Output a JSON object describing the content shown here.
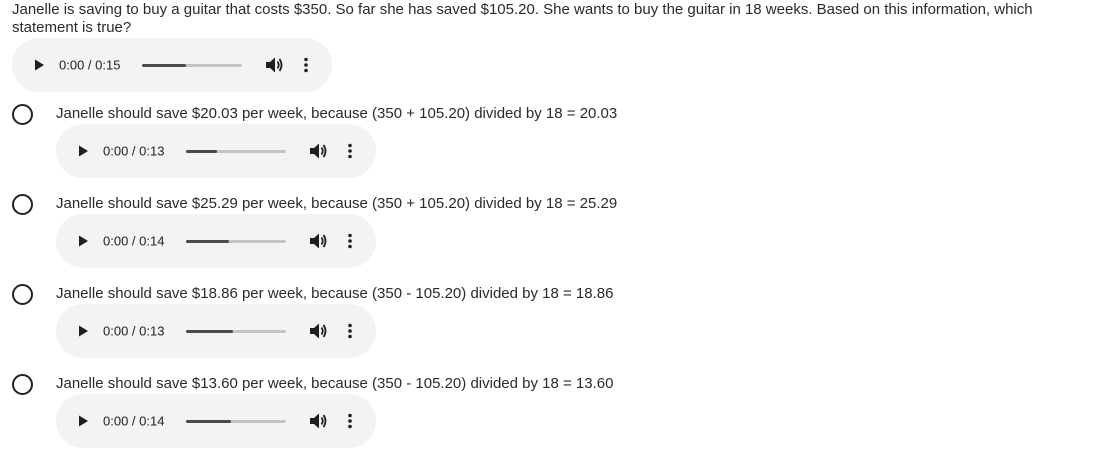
{
  "question": {
    "text": "Janelle is saving to buy a guitar that costs $350.  So far she has saved $105.20.  She wants to buy the guitar in 18 weeks.  Based on this information, which statement is true?",
    "audio": {
      "time": "0:00 / 0:15",
      "progress": 0.44
    }
  },
  "options": [
    {
      "label": "Janelle should save $20.03 per week, because (350 + 105.20) divided by 18 = 20.03",
      "audio": {
        "time": "0:00 / 0:13",
        "progress": 0.31
      }
    },
    {
      "label": "Janelle should save $25.29 per week, because (350 + 105.20) divided by 18 = 25.29",
      "audio": {
        "time": "0:00 / 0:14",
        "progress": 0.43
      }
    },
    {
      "label": "Janelle should save $18.86 per week, because (350 - 105.20) divided by 18 = 18.86",
      "audio": {
        "time": "0:00 / 0:13",
        "progress": 0.47
      }
    },
    {
      "label": "Janelle should save $13.60 per week, because (350 - 105.20) divided by 18 = 13.60",
      "audio": {
        "time": "0:00 / 0:14",
        "progress": 0.45
      }
    }
  ],
  "icons": {
    "play": "play-icon",
    "volume": "volume-icon",
    "more": "more-vertical-icon",
    "radio": "radio-unselected"
  },
  "colors": {
    "player_bg": "#f1f3f4",
    "track": "#c4c4c4",
    "track_fill": "#4a4a4a",
    "text": "#2a2a2a"
  }
}
